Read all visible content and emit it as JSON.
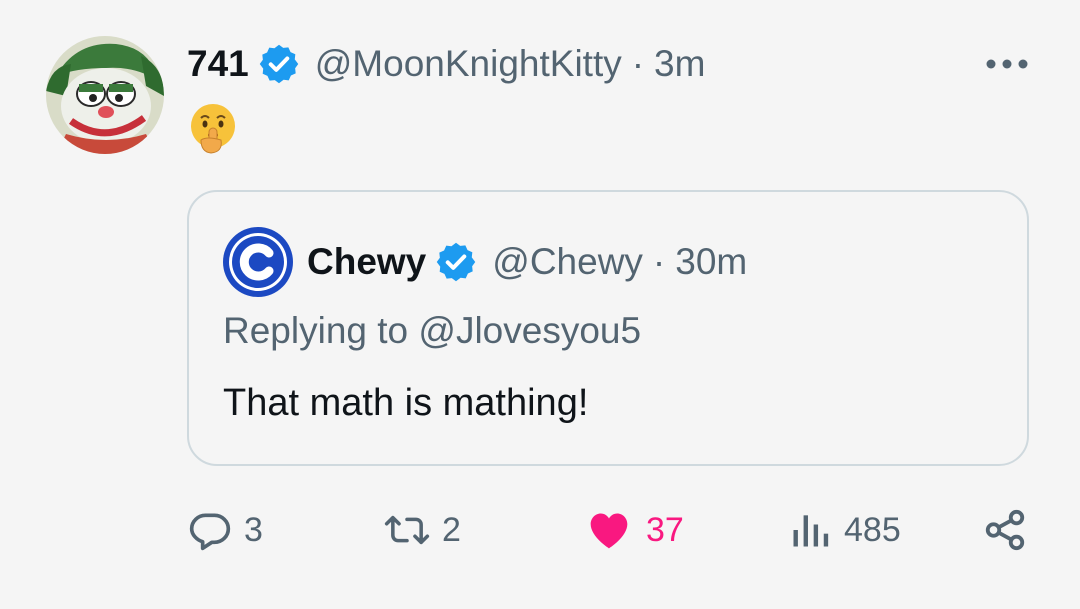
{
  "tweet": {
    "display_name": "741",
    "handle": "@MoonKnightKitty",
    "separator": "·",
    "time": "3m",
    "emoji": "🤫",
    "avatar": "joker-garfield-avatar",
    "more_icon": "more-horizontal-icon"
  },
  "quoted": {
    "display_name": "Chewy",
    "handle": "@Chewy",
    "separator": "·",
    "time": "30m",
    "replying_to": "Replying to @Jlovesyou5",
    "text": "That math is mathing!",
    "logo": "chewy-logo"
  },
  "actions": {
    "replies": "3",
    "retweets": "2",
    "likes": "37",
    "views": "485"
  },
  "colors": {
    "verified": "#1d9bf0",
    "like": "#f91880",
    "muted": "#536471",
    "chewy_blue": "#1c49c2"
  }
}
